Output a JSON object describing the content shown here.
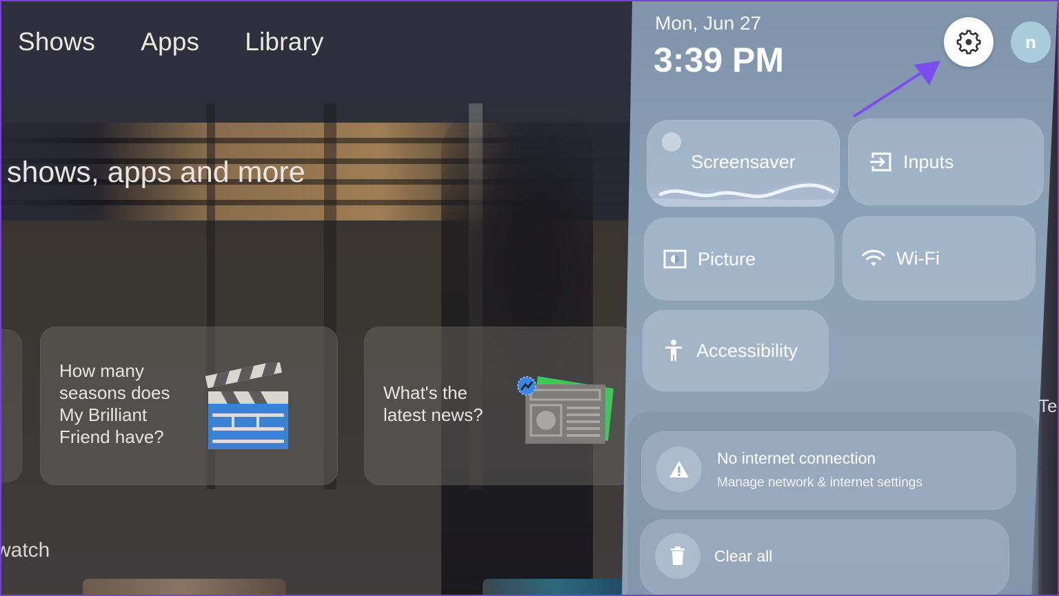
{
  "home": {
    "nav": [
      {
        "label": "Shows"
      },
      {
        "label": "Apps"
      },
      {
        "label": "Library"
      }
    ],
    "hero_text": "shows, apps and more",
    "suggestion_cards": [
      {
        "lines": [
          "How many",
          "seasons does",
          "My Brilliant",
          "Friend have?"
        ],
        "icon": "clapperboard-icon"
      },
      {
        "lines": [
          "What's the",
          "latest news?"
        ],
        "icon": "newspaper-icon"
      }
    ],
    "row_title": "watch",
    "partial_label_right": "Tel"
  },
  "quick_settings": {
    "date": "Mon, Jun 27",
    "time": "3:39 PM",
    "settings_icon": "gear-icon",
    "avatar_initial": "n",
    "tiles": [
      {
        "label": "Screensaver",
        "icon": "moon-landscape-icon"
      },
      {
        "label": "Inputs",
        "icon": "input-icon"
      },
      {
        "label": "Picture",
        "icon": "picture-settings-icon"
      },
      {
        "label": "Wi-Fi",
        "icon": "wifi-icon"
      },
      {
        "label": "Accessibility",
        "icon": "accessibility-icon"
      }
    ],
    "notifications": [
      {
        "title": "No internet connection",
        "subtitle": "Manage network & internet settings",
        "icon": "warning-icon"
      },
      {
        "title": "Clear all",
        "icon": "trash-icon"
      }
    ]
  },
  "annotation": {
    "arrow_color": "#7b4cf0",
    "points_to": "settings"
  },
  "colors": {
    "frame": "#7a3fe0",
    "panel": "#8aa0b6",
    "avatar": "#a9cbdb"
  }
}
